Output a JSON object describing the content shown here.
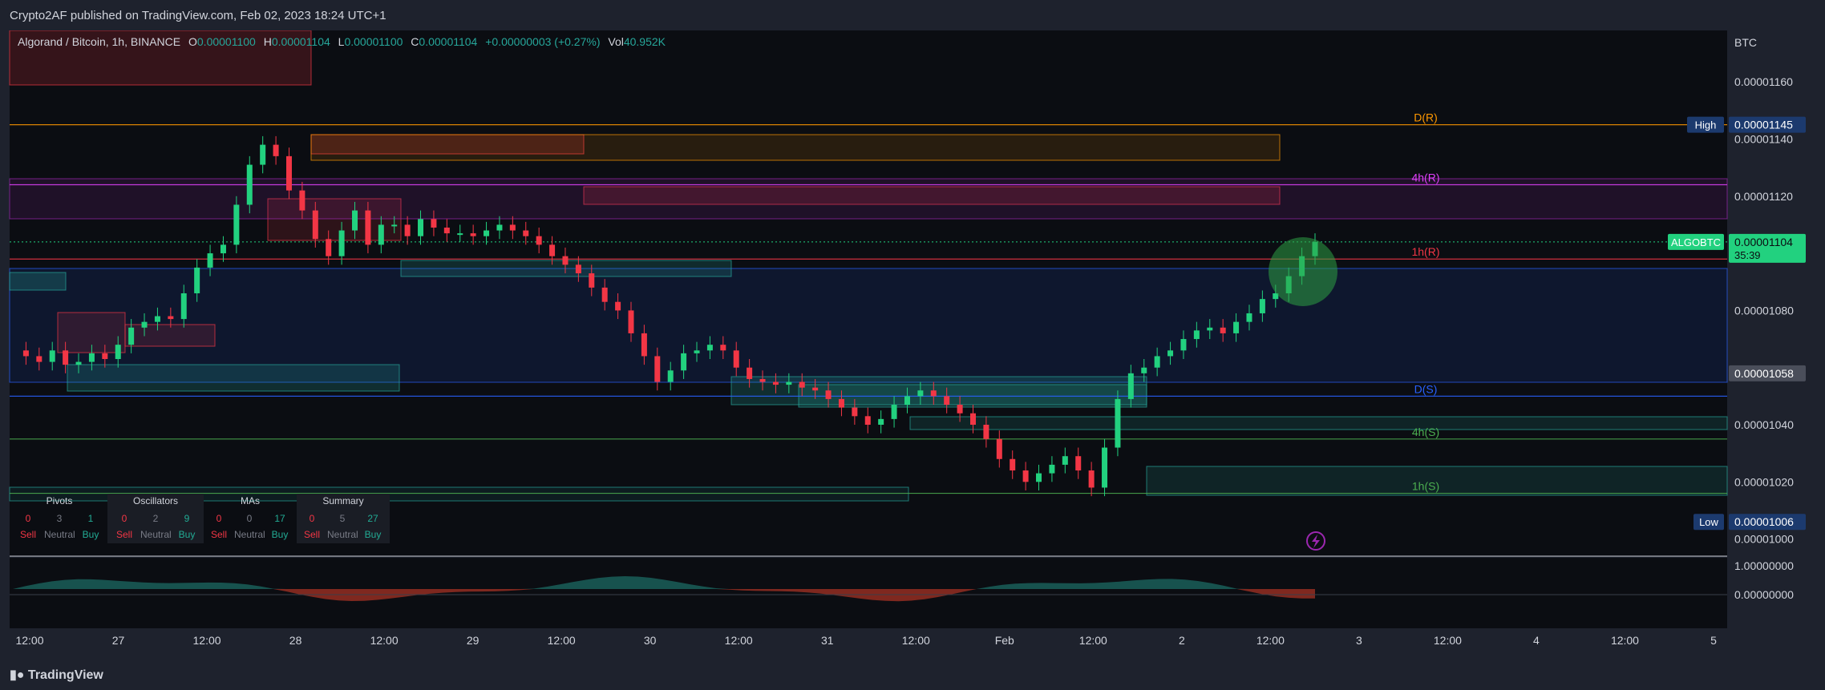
{
  "header": {
    "publisher": "Crypto2AF published on TradingView.com, Feb 02, 2023 18:24 UTC+1"
  },
  "footer": {
    "brand": "TradingView"
  },
  "legend": {
    "symbol": "Algorand / Bitcoin, 1h, BINANCE",
    "o_label": "O",
    "o": "0.00001100",
    "h_label": "H",
    "h": "0.00001104",
    "l_label": "L",
    "l": "0.00001100",
    "c_label": "C",
    "c": "0.00001104",
    "change": "+0.00000003 (+0.27%)",
    "vol_label": "Vol",
    "vol": "40.952K"
  },
  "summary": {
    "groups": [
      {
        "title": "Pivots",
        "sell": "0",
        "neutral": "3",
        "buy": "1"
      },
      {
        "title": "Oscillators",
        "sell": "0",
        "neutral": "2",
        "buy": "9"
      },
      {
        "title": "MAs",
        "sell": "0",
        "neutral": "0",
        "buy": "17"
      },
      {
        "title": "Summary",
        "sell": "0",
        "neutral": "5",
        "buy": "27"
      }
    ],
    "sell_label": "Sell",
    "neutral_label": "Neutral",
    "buy_label": "Buy"
  },
  "colors": {
    "up": "#22d17f",
    "down": "#f23645",
    "background": "#0b0d12",
    "panel": "#1e222d",
    "blue_line": "#2962ff",
    "green_zone": "#26a69a",
    "red_zone": "#f23645"
  },
  "chart_data": {
    "type": "candlestick",
    "currency": "BTC",
    "y_range": [
      9.94e-06,
      1.178e-05
    ],
    "y_ticks": [
      "0.00001160",
      "0.00001140",
      "0.00001120",
      "0.00001080",
      "0.00001040",
      "0.00001020",
      "0.00001000"
    ],
    "x_ticks": [
      "12:00",
      "27",
      "12:00",
      "28",
      "12:00",
      "29",
      "12:00",
      "30",
      "12:00",
      "31",
      "12:00",
      "Feb",
      "12:00",
      "2",
      "12:00",
      "3",
      "12:00",
      "4",
      "12:00",
      "5"
    ],
    "price_badges": [
      {
        "label": "High",
        "value": "0.00001145"
      },
      {
        "label": "ALGOBTC",
        "value": "0.00001104",
        "countdown": "35:39"
      },
      {
        "label": "",
        "value": "0.00001058"
      },
      {
        "label": "Low",
        "value": "0.00001006"
      }
    ],
    "levels": [
      {
        "label": "D(R)",
        "value": 1.145e-05
      },
      {
        "label": "4h(R)",
        "value": 1.124e-05
      },
      {
        "label": "1h(R)",
        "value": 1.098e-05
      },
      {
        "label": "D(S)",
        "value": 1.05e-05
      },
      {
        "label": "4h(S)",
        "value": 1.035e-05
      },
      {
        "label": "1h(S)",
        "value": 1.016e-05
      }
    ],
    "candle_path": [
      [
        0,
        1066
      ],
      [
        8,
        1064
      ],
      [
        16,
        1062
      ],
      [
        24,
        1066
      ],
      [
        32,
        1061
      ],
      [
        40,
        1062
      ],
      [
        48,
        1065
      ],
      [
        56,
        1063
      ],
      [
        64,
        1068
      ],
      [
        72,
        1074
      ],
      [
        80,
        1076
      ],
      [
        88,
        1078
      ],
      [
        96,
        1077
      ],
      [
        104,
        1086
      ],
      [
        112,
        1095
      ],
      [
        120,
        1100
      ],
      [
        128,
        1103
      ],
      [
        136,
        1117
      ],
      [
        144,
        1131
      ],
      [
        152,
        1138
      ],
      [
        160,
        1134
      ],
      [
        168,
        1122
      ],
      [
        176,
        1115
      ],
      [
        184,
        1105
      ],
      [
        192,
        1099
      ],
      [
        200,
        1108
      ],
      [
        208,
        1115
      ],
      [
        216,
        1103
      ],
      [
        224,
        1110
      ],
      [
        232,
        1110
      ],
      [
        240,
        1106
      ],
      [
        248,
        1112
      ],
      [
        256,
        1109
      ],
      [
        264,
        1107
      ],
      [
        272,
        1107
      ],
      [
        280,
        1106
      ],
      [
        288,
        1108
      ],
      [
        296,
        1110
      ],
      [
        304,
        1108
      ],
      [
        312,
        1106
      ],
      [
        320,
        1103
      ],
      [
        328,
        1099
      ],
      [
        336,
        1096
      ],
      [
        344,
        1093
      ],
      [
        352,
        1088
      ],
      [
        360,
        1083
      ],
      [
        368,
        1080
      ],
      [
        376,
        1072
      ],
      [
        384,
        1064
      ],
      [
        392,
        1055
      ],
      [
        400,
        1059
      ],
      [
        408,
        1065
      ],
      [
        416,
        1066
      ],
      [
        424,
        1068
      ],
      [
        432,
        1066
      ],
      [
        440,
        1060
      ],
      [
        448,
        1056
      ],
      [
        456,
        1055
      ],
      [
        464,
        1054
      ],
      [
        472,
        1055
      ],
      [
        480,
        1053
      ],
      [
        488,
        1052
      ],
      [
        496,
        1049
      ],
      [
        504,
        1046
      ],
      [
        512,
        1043
      ],
      [
        520,
        1040
      ],
      [
        528,
        1042
      ],
      [
        536,
        1047
      ],
      [
        544,
        1050
      ],
      [
        552,
        1052
      ],
      [
        560,
        1050
      ],
      [
        568,
        1047
      ],
      [
        576,
        1044
      ],
      [
        584,
        1040
      ],
      [
        592,
        1035
      ],
      [
        600,
        1028
      ],
      [
        608,
        1024
      ],
      [
        616,
        1020
      ],
      [
        624,
        1023
      ],
      [
        632,
        1026
      ],
      [
        640,
        1029
      ],
      [
        648,
        1024
      ],
      [
        656,
        1018
      ],
      [
        664,
        1032
      ],
      [
        672,
        1049
      ],
      [
        680,
        1058
      ],
      [
        688,
        1060
      ],
      [
        696,
        1064
      ],
      [
        704,
        1066
      ],
      [
        712,
        1070
      ],
      [
        720,
        1073
      ],
      [
        728,
        1074
      ],
      [
        736,
        1072
      ],
      [
        744,
        1076
      ],
      [
        752,
        1079
      ],
      [
        760,
        1084
      ],
      [
        768,
        1086
      ],
      [
        776,
        1092
      ],
      [
        784,
        1099
      ],
      [
        792,
        1104
      ]
    ],
    "indicator": {
      "y_ticks": [
        "1.00000000",
        "0.00000000"
      ]
    }
  }
}
